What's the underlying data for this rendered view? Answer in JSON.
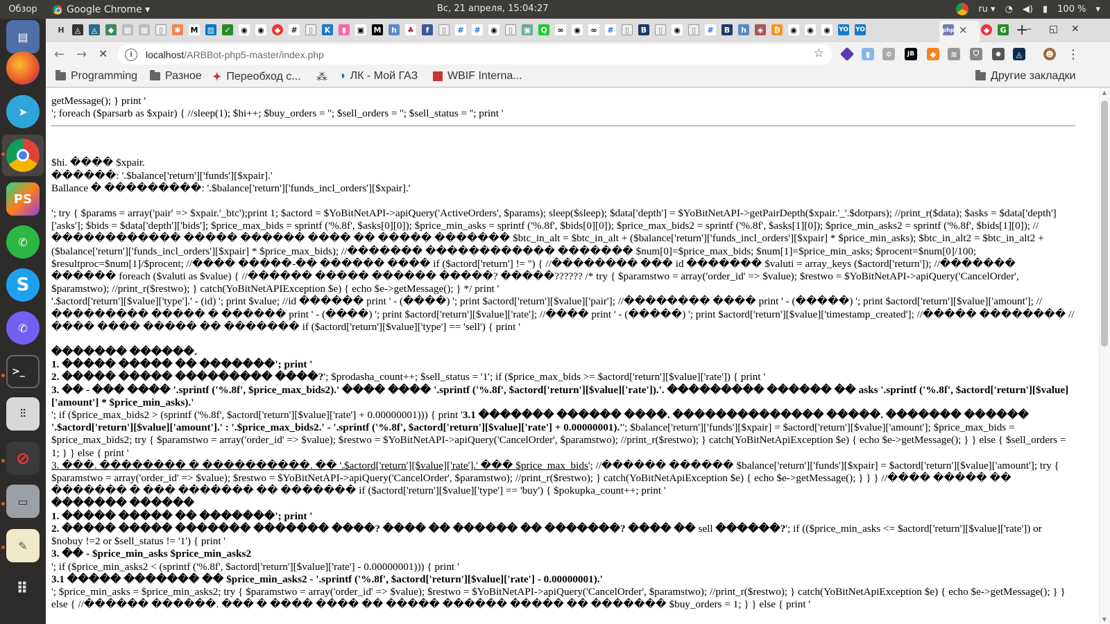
{
  "topbar": {
    "overview": "Обзор",
    "app_name": "Google Chrome ▾",
    "clock": "Вс, 21 апреля, 15:04:27",
    "language": "ru ▾",
    "battery": "100 %"
  },
  "dock": {
    "items": [
      "files",
      "firefox",
      "telegram",
      "chrome",
      "phpstorm",
      "whatsapp",
      "skype",
      "viber",
      "terminal",
      "mixer",
      "no-entry",
      "scanner",
      "text-editor",
      "app-grid"
    ]
  },
  "tabs": {
    "first_letter": "Н",
    "close_label": "×",
    "new_tab_label": "+"
  },
  "toolbar": {
    "back_label": "←",
    "forward_label": "→",
    "stop_label": "✕",
    "url_host": "localhost",
    "url_path": "/ARBBot-php5-master/index.php",
    "star_label": "☆",
    "menu_label": "⋮"
  },
  "bookmarks": {
    "items": [
      "Programming",
      "Разное",
      "Переобход с...",
      "",
      "ЛК - Мой ГАЗ",
      "WBIF Interna..."
    ],
    "other": "Другие закладки"
  },
  "page": {
    "line1": "getMessage(); } print '",
    "line2": "'; foreach ($parsarb as $xpair) { //sleep(1); $hi++; $buy_orders = ''; $sell_orders = ''; $sell_status = ''; print '",
    "block1_l1": "$hi. ���� $xpair.",
    "block1_l2": "������: '.$balance['return']['funds'][$xpair].'",
    "block1_l3": "Ballance � ���������: '.$balance['return']['funds_incl_orders'][$xpair].'",
    "para1": "'; try { $params = array('pair' => $xpair.'_btc');print 1; $actord = $YoBitNetAPI->apiQuery('ActiveOrders', $params); sleep($sleep); $data['depth'] = $YoBitNetAPI->getPairDepth($xpair.'_'.$dotpars); //print_r($data); $asks = $data['depth']['asks']; $bids = $data['depth']['bids']; $price_max_bids = sprintf ('%.8f', $asks[0][0]); $price_min_asks = sprintf ('%.8f', $bids[0][0]); $price_max_bids2 = sprintf ('%.8f', $asks[1][0]); $price_min_asks2 = sprintf ('%.8f', $bids[1][0]); //������������ ����� ������ ���� �� ����� ������� $btc_in_alt = $btc_in_alt + ($balance['return']['funds_incl_orders'][$xpair] * $price_min_asks); $btc_in_alt2 = $btc_in_alt2 + ($balance['return']['funds_incl_orders'][$xpair] * $price_max_bids); //������� ������������ ������� $num[0]=$price_max_bids; $num[1]=$price_min_asks; $procent=$num[0]/100; $resultproc=$num[1]/$procent; //���� �����-�� ������ ���� if ($actord['return'] != '') { //�������� ��� id ������� $valuti = array_keys ($actord['return']); //������� ������ foreach ($valuti as $value) { //������ ����� ������ �����? �����?????? /* try { $paramstwo = array('order_id' => $value); $restwo = $YoBitNetAPI->apiQuery('CancelOrder', $paramstwo); //print_r($restwo); } catch(YoBitNetAPIException $e) { echo $e->getMessage(); } */ print '",
    "para2": "'.$actord['return'][$value]['type'].' - (id) '; print $value; //id ������ print ' - (����) '; print $actord['return'][$value]['pair']; //�������� ���� print ' - (�����) '; print $actord['return'][$value]['amount']; //��������� ����� � ������ print ' - (����) '; print $actord['return'][$value]['rate']; //���� print ' - (�����) '; print $actord['return'][$value]['timestamp_created']; //����� �������� //���� ���� ����� �� ������� if ($actord['return'][$value]['type'] == 'sell') { print '",
    "sell_title": "������� ������.",
    "sell_1": "1. ����� ����� �� �������'; print '",
    "sell_2a": "2. ����� ����� ��������� ����?",
    "sell_2b": "'; $prodasha_count++; $sell_status = '1'; if ($price_max_bids >= $actord['return'][$value]['rate']) { print '",
    "sell_3": "3. �� - ��� ���� '.sprintf ('%.8f', $price_max_bids2).' ���� ���� '.sprintf ('%.8f', $actord['return'][$value]['rate']).'. ��������� ������ �� asks '.sprintf ('%.8f', $actord['return'][$value]['amount'] * $price_min_asks).'",
    "sell_31a": "'; if ($price_max_bids2 > (sprintf ('%.8f', $actord['return'][$value]['rate'] + 0.00000001))) { print '",
    "sell_31b": "3.1 ������� ������ ����. �������������� �����. ������� ������ '.$actord['return'][$value]['amount'].' : '.$price_max_bids2.' - '.sprintf ('%.8f', $actord['return'][$value]['rate'] + 0.00000001).'",
    "sell_31c": "'; $balance['return']['funds'][$xpair] = $actord['return'][$value]['amount']; $price_max_bids = $price_max_bids2; try { $paramstwo = array('order_id' => $value); $restwo = $YoBitNetAPI->apiQuery('CancelOrder', $paramstwo); //print_r($restwo); } catch(YoBitNetApiException $e) { echo $e->getMessage(); } } else { $sell_orders = 1; } } else { print '",
    "sell_3u": "3. ���. �������� � ����������. �� '.$actord['return'][$value]['rate'].' ��� $price_max_bids",
    "sell_3u_tail": "'; //������ ������ $balance['return']['funds'][$xpair] = $actord['return'][$value]['amount']; try { $paramstwo = array('order_id' => $value); $restwo = $YoBitNetAPI->apiQuery('CancelOrder', $paramstwo); //print_r($restwo); } catch(YoBitNetApiException $e) { echo $e->getMessage(); } } } //���� ����� �� ������� � ��� ������� �� ������� if ($actord['return'][$value]['type'] == 'buy') { $pokupka_count++; print '",
    "buy_title": "������� ������",
    "buy_1": "1. ����� ����� �� �������'; print '",
    "buy_2a": "2. ����� ����� ������� ������� ����? ���� �� ������ �� �������? ���� ��",
    "buy_2sell": "sell",
    "buy_2b": "������?",
    "buy_2c": "'; if (($price_min_asks <= $actord['return'][$value]['rate']) or $nobuy !=2 or $sell_status != '1') { print '",
    "buy_3": "3. �� - $price_min_asks $price_min_asks2",
    "buy_3a": "'; if ($price_min_asks2 < (sprintf ('%.8f', $actord['return'][$value]['rate'] - 0.00000001))) { print '",
    "buy_31": "3.1 ����� ������� �� $price_min_asks2 - '.sprintf ('%.8f', $actord['return'][$value]['rate'] - 0.00000001).'",
    "buy_31b": "'; $price_min_asks = $price_min_asks2; try { $paramstwo = array('order_id' => $value); $restwo = $YoBitNetAPI->apiQuery('CancelOrder', $paramstwo); //print_r($restwo); } catch(YoBitNetApiException $e) { echo $e->getMessage(); } } else { //������ ������. ��� � ���� ���� �� ����� ������ ����� �� ������� $buy_orders = 1; } } else { print '"
  }
}
